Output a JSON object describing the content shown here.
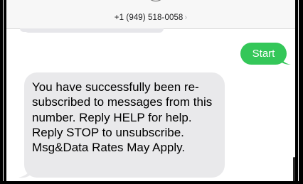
{
  "header": {
    "contact_number": "+1 (949) 518-0058",
    "chevron": "›"
  },
  "conversation": {
    "sent_message": "Start",
    "received_message": "You have successfully been re-subscribed to messages from this number. Reply HELP for help. Reply STOP to unsubscribe. Msg&Data Rates May Apply."
  },
  "colors": {
    "sent_bubble": "#34c759",
    "received_bubble": "#e9e9eb",
    "header_bg": "#f7f7f7"
  }
}
